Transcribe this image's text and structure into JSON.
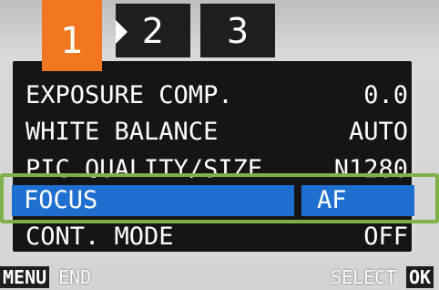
{
  "tabs": [
    {
      "label": "1",
      "active": true
    },
    {
      "label": "2",
      "active": false
    },
    {
      "label": "3",
      "active": false
    }
  ],
  "menu": {
    "rows": [
      {
        "label": "EXPOSURE COMP.",
        "value": "0.0"
      },
      {
        "label": "WHITE BALANCE",
        "value": "AUTO"
      },
      {
        "label": "PIC QUALITY/SIZE",
        "value": "N1280"
      },
      {
        "label": "FOCUS",
        "value": "AF",
        "selected": true
      },
      {
        "label": "CONT. MODE",
        "value": "OFF"
      }
    ]
  },
  "footer": {
    "menu_key": "MENU",
    "end_label": "END",
    "select_label": "SELECT",
    "ok_key": "OK"
  },
  "colors": {
    "active_tab": "#f0761f",
    "selection": "#1f6fd0",
    "highlight_frame": "#7fb04b",
    "panel": "#151515"
  },
  "icons": {
    "tab_pointer": "triangle-right-icon"
  }
}
